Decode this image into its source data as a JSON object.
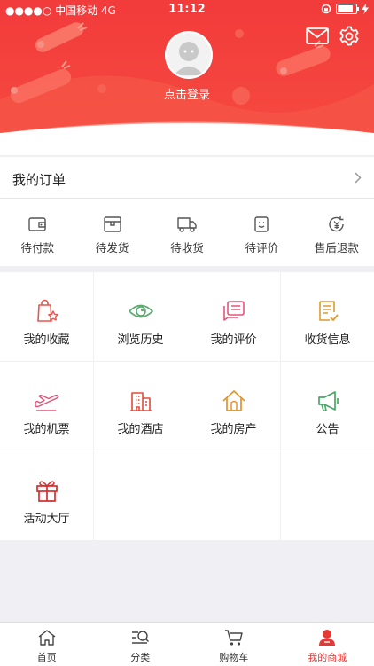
{
  "status_bar": {
    "carrier": "●●●●○ 中国移动  4G",
    "time": "11:12",
    "battery_level": 0.85
  },
  "header": {
    "login_label": "点击登录",
    "accent_color": "#f23b3b"
  },
  "orders": {
    "title": "我的订单",
    "items": [
      {
        "label": "待付款",
        "icon": "wallet-icon"
      },
      {
        "label": "待发货",
        "icon": "package-icon"
      },
      {
        "label": "待收货",
        "icon": "truck-icon"
      },
      {
        "label": "待评价",
        "icon": "review-icon"
      },
      {
        "label": "售后退款",
        "icon": "refund-icon"
      }
    ]
  },
  "services": [
    {
      "label": "我的收藏",
      "icon": "favorites-bag-icon",
      "color": "#e8554e"
    },
    {
      "label": "浏览历史",
      "icon": "eye-icon",
      "color": "#5aa96e"
    },
    {
      "label": "我的评价",
      "icon": "comment-icon",
      "color": "#e8557a"
    },
    {
      "label": "收货信息",
      "icon": "address-list-icon",
      "color": "#e09a2c"
    },
    {
      "label": "我的机票",
      "icon": "plane-icon",
      "color": "#e0557a"
    },
    {
      "label": "我的酒店",
      "icon": "hotel-icon",
      "color": "#e24b3b"
    },
    {
      "label": "我的房产",
      "icon": "house-icon",
      "color": "#e0952e"
    },
    {
      "label": "公告",
      "icon": "megaphone-icon",
      "color": "#4aa566"
    },
    {
      "label": "活动大厅",
      "icon": "gift-icon",
      "color": "#d43030"
    }
  ],
  "tabbar": {
    "items": [
      {
        "label": "首页",
        "icon": "home-icon",
        "active": false
      },
      {
        "label": "分类",
        "icon": "category-search-icon",
        "active": false
      },
      {
        "label": "购物车",
        "icon": "cart-icon",
        "active": false
      },
      {
        "label": "我的商城",
        "icon": "profile-icon",
        "active": true
      }
    ]
  }
}
